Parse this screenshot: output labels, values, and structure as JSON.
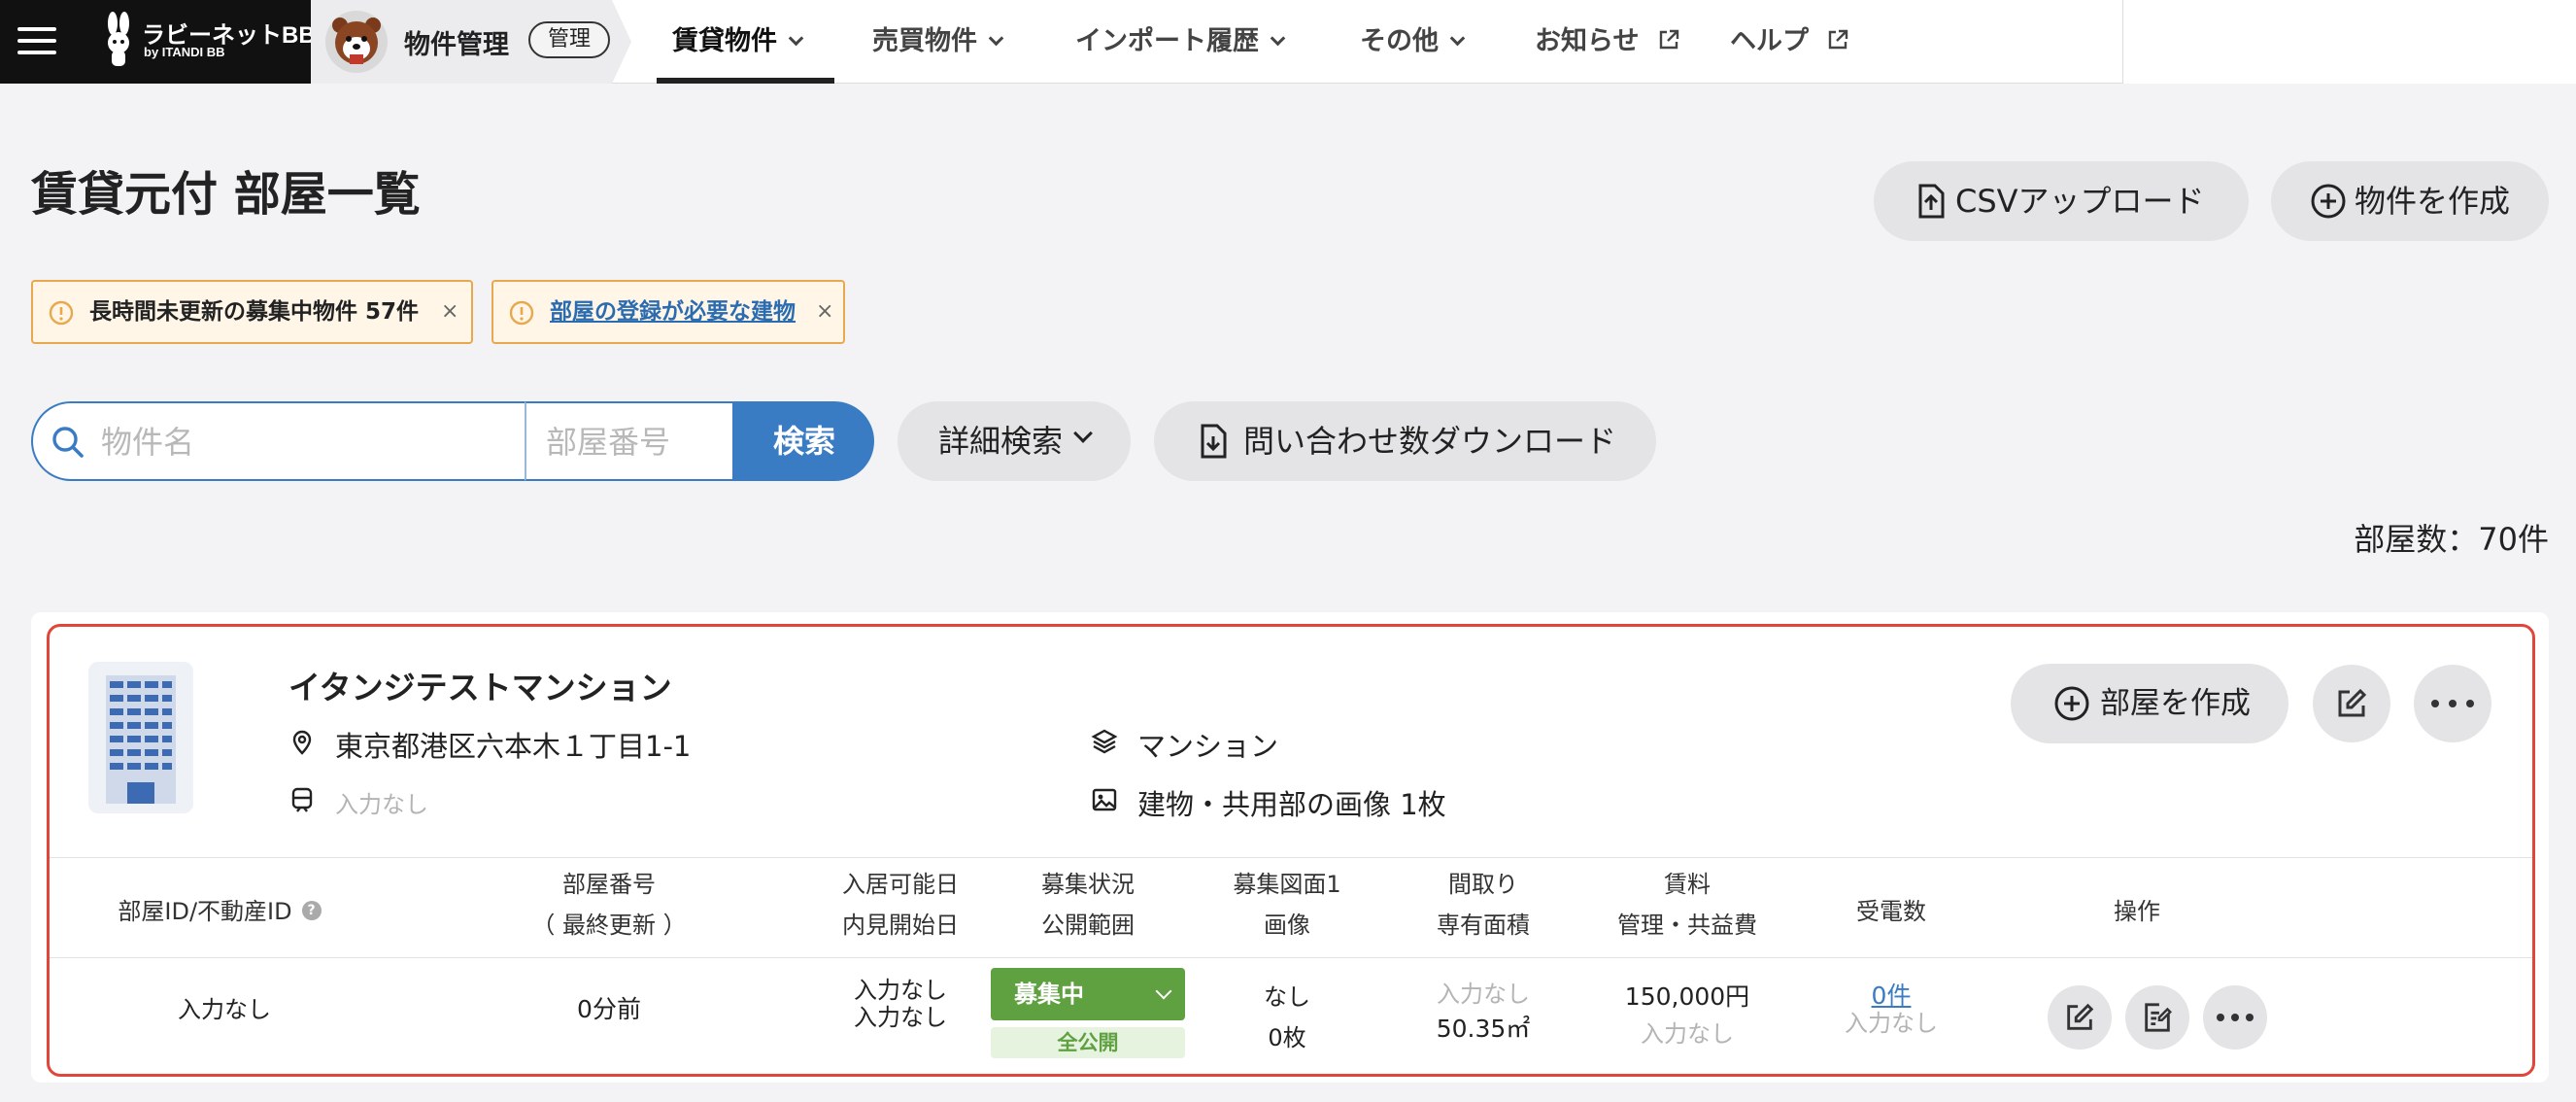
{
  "brand": {
    "name": "ラビーネットBB",
    "sub": "by ITANDI BB"
  },
  "app": {
    "title": "物件管理",
    "badge": "管理"
  },
  "nav": {
    "items": [
      {
        "label": "賃貸物件"
      },
      {
        "label": "売買物件"
      },
      {
        "label": "インポート履歴"
      },
      {
        "label": "その他"
      },
      {
        "label": "お知らせ"
      },
      {
        "label": "ヘルプ"
      }
    ]
  },
  "page": {
    "title": "賃貸元付 部屋一覧",
    "csv_upload": "CSVアップロード",
    "create_property": "物件を作成",
    "room_count": "部屋数：70件"
  },
  "alerts": [
    {
      "text": "長時間未更新の募集中物件 57件",
      "close": "×"
    },
    {
      "text": "部屋の登録が必要な建物",
      "close": "×"
    }
  ],
  "search": {
    "name_placeholder": "物件名",
    "room_placeholder": "部屋番号",
    "button": "検索",
    "advanced": "詳細検索",
    "download": "問い合わせ数ダウンロード"
  },
  "property": {
    "name": "イタンジテストマンション",
    "address": "東京都港区六本木１丁目1-1",
    "type": "マンション",
    "station": "入力なし",
    "images": "建物・共用部の画像 1枚",
    "create_room": "部屋を作成"
  },
  "table": {
    "headers": [
      {
        "l1": "部屋ID/不動産ID",
        "l2": ""
      },
      {
        "l1": "部屋番号",
        "l2": "（ 最終更新 ）"
      },
      {
        "l1": "入居可能日",
        "l2": "内見開始日"
      },
      {
        "l1": "募集状況",
        "l2": "公開範囲"
      },
      {
        "l1": "募集図面1",
        "l2": "画像"
      },
      {
        "l1": "間取り",
        "l2": "専有面積"
      },
      {
        "l1": "賃料",
        "l2": "管理・共益費"
      },
      {
        "l1": "受電数",
        "l2": ""
      },
      {
        "l1": "操作",
        "l2": ""
      }
    ],
    "help_mark": "?",
    "row": {
      "room_id": "入力なし",
      "updated": "0分前",
      "move_in": "入力なし",
      "viewing": "入力なし",
      "status": "募集中",
      "scope": "全公開",
      "drawing": "なし",
      "images": "0枚",
      "layout": "入力なし",
      "area": "50.35㎡",
      "rent": "150,000円",
      "fee": "入力なし",
      "calls": "0件",
      "calls_sub": "入力なし"
    }
  },
  "colors": {
    "primary": "#3a7cc4",
    "status_green": "#5fa041",
    "alert_border": "#e8a94e",
    "card_border": "#e0473a"
  }
}
